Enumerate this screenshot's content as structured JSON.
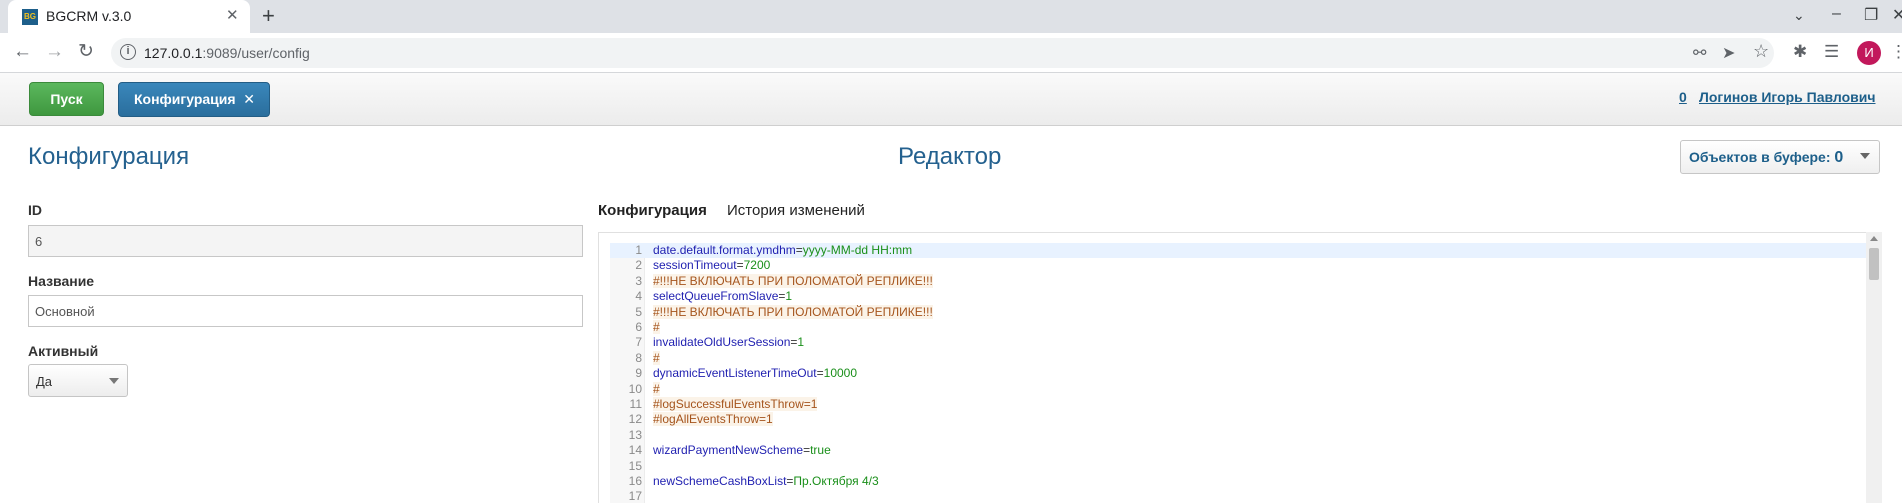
{
  "browser": {
    "tab_title": "BGCRM v.3.0",
    "tab_favicon_text": "BG",
    "tab_close": "✕",
    "new_tab": "+",
    "url_host": "127.0.0.1",
    "url_rest": ":9089/user/config",
    "avatar_letter": "И"
  },
  "appbar": {
    "start_label": "Пуск",
    "config_tab_label": "Конфигурация",
    "config_tab_close": "✕",
    "user_count": "0",
    "user_name": "Логинов Игорь Павлович"
  },
  "page": {
    "title": "Конфигурация",
    "editor_title": "Редактор",
    "buffer_label": "Объектов в буфере: ",
    "buffer_count": "0"
  },
  "form": {
    "id_label": "ID",
    "id_value": "6",
    "name_label": "Название",
    "name_value": "Основной",
    "active_label": "Активный",
    "active_value": "Да"
  },
  "editor": {
    "tabs": [
      "Конфигурация",
      "История изменений"
    ],
    "lines": [
      {
        "num": "1",
        "type": "kv",
        "key": "date.default.format.ymdhm",
        "value": "yyyy-MM-dd HH:mm"
      },
      {
        "num": "2",
        "type": "kv",
        "key": "sessionTimeout",
        "value": "7200"
      },
      {
        "num": "3",
        "type": "comment",
        "text": "#!!!НЕ ВКЛЮЧАТЬ ПРИ ПОЛОМАТОЙ РЕПЛИКЕ!!!"
      },
      {
        "num": "4",
        "type": "kv",
        "key": "selectQueueFromSlave",
        "value": "1"
      },
      {
        "num": "5",
        "type": "comment",
        "text": "#!!!НЕ ВКЛЮЧАТЬ ПРИ ПОЛОМАТОЙ РЕПЛИКЕ!!!"
      },
      {
        "num": "6",
        "type": "comment",
        "text": "#"
      },
      {
        "num": "7",
        "type": "kv",
        "key": "invalidateOldUserSession",
        "value": "1"
      },
      {
        "num": "8",
        "type": "comment",
        "text": "#"
      },
      {
        "num": "9",
        "type": "kv",
        "key": "dynamicEventListenerTimeOut",
        "value": "10000"
      },
      {
        "num": "10",
        "type": "comment",
        "text": "#"
      },
      {
        "num": "11",
        "type": "comment",
        "text": "#logSuccessfulEventsThrow=1"
      },
      {
        "num": "12",
        "type": "comment",
        "text": "#logAllEventsThrow=1"
      },
      {
        "num": "13",
        "type": "empty"
      },
      {
        "num": "14",
        "type": "kv",
        "key": "wizardPaymentNewScheme",
        "value": "true"
      },
      {
        "num": "15",
        "type": "empty"
      },
      {
        "num": "16",
        "type": "kv",
        "key": "newSchemeCashBoxList",
        "value": "Пр.Октября 4/3"
      },
      {
        "num": "17",
        "type": "empty"
      }
    ]
  },
  "icons": {
    "back": "back-arrow-icon",
    "forward": "forward-arrow-icon",
    "reload": "reload-icon",
    "key": "key-icon",
    "send": "send-icon",
    "star": "star-icon",
    "puzzle": "extensions-icon",
    "media": "media-icon",
    "menu": "menu-icon"
  }
}
